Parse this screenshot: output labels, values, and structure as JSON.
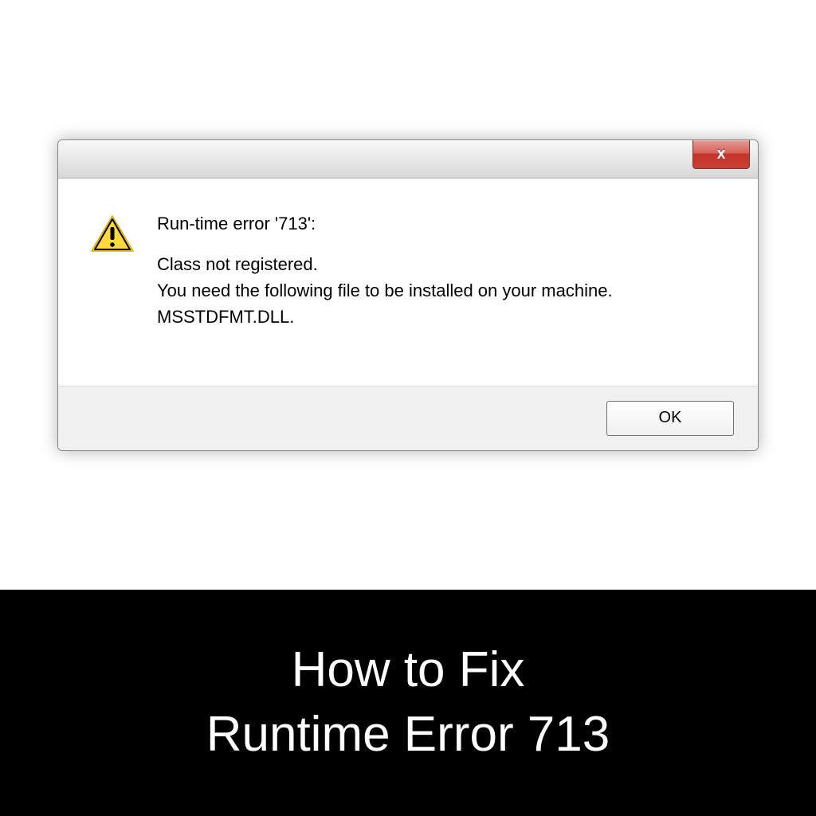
{
  "dialog": {
    "close_glyph": "x",
    "message": {
      "heading": "Run-time error '713':",
      "line1": "Class not registered.",
      "line2": "You need the following file to be installed on your machine.",
      "line3": "MSSTDFMT.DLL."
    },
    "ok_label": "OK"
  },
  "banner": {
    "line1": "How to Fix",
    "line2": "Runtime Error 713"
  },
  "icons": {
    "warning": "warning-icon",
    "close": "close-icon"
  }
}
